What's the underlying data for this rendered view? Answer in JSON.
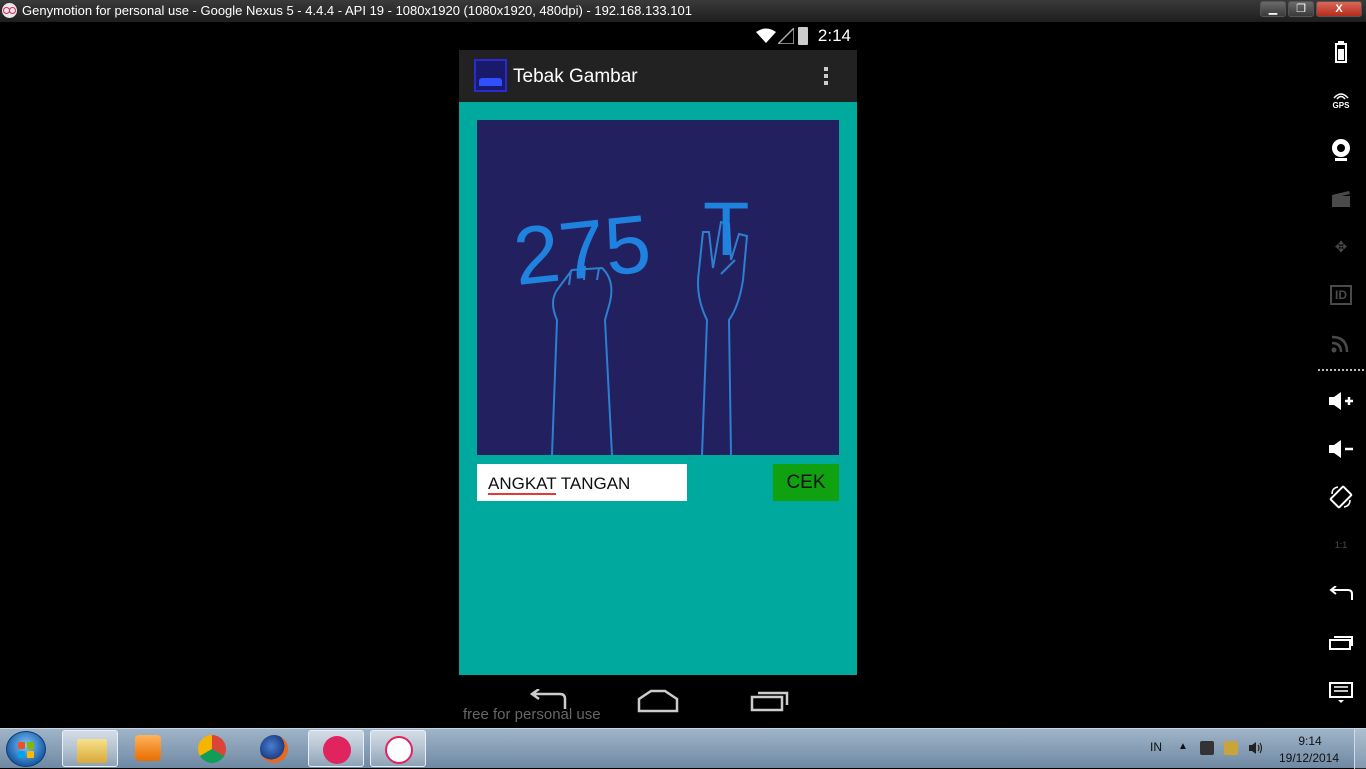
{
  "window": {
    "title": "Genymotion for personal use - Google Nexus 5 - 4.4.4 - API 19 - 1080x1920 (1080x1920, 480dpi) - 192.168.133.101",
    "minimize": "▁",
    "maximize": "❐",
    "close": "X"
  },
  "statusbar": {
    "time": "2:14"
  },
  "app": {
    "title": "Tebak Gambar"
  },
  "puzzle": {
    "number_text": "275",
    "letter_text": "T"
  },
  "answer": {
    "value_part1": "ANGKAT",
    "value_part2": " TANGAN"
  },
  "check_button": {
    "label": "CEK"
  },
  "watermark": "free for personal use",
  "sidebar": {
    "items": [
      {
        "icon": "battery-icon",
        "enabled": true
      },
      {
        "icon": "gps-icon",
        "label": "GPS",
        "enabled": true
      },
      {
        "icon": "webcam-icon",
        "enabled": true
      },
      {
        "icon": "screencast-icon",
        "enabled": false
      },
      {
        "icon": "move-icon",
        "enabled": false
      },
      {
        "icon": "id-icon",
        "label": "ID",
        "enabled": false
      },
      {
        "icon": "rss-icon",
        "enabled": false
      },
      {
        "icon": "volume-up-icon",
        "enabled": true
      },
      {
        "icon": "volume-down-icon",
        "enabled": true
      },
      {
        "icon": "rotate-icon",
        "enabled": true
      },
      {
        "icon": "scale-icon",
        "label": "1:1",
        "enabled": false
      },
      {
        "icon": "back-icon",
        "enabled": true
      },
      {
        "icon": "recent-apps-icon",
        "enabled": true
      },
      {
        "icon": "menu-icon",
        "enabled": true
      }
    ]
  },
  "taskbar": {
    "apps": [
      "windows-explorer-icon",
      "media-player-icon",
      "chrome-icon",
      "firefox-icon",
      "genymotion-icon",
      "genymotion-player-icon"
    ],
    "language": "IN",
    "time": "9:14",
    "date": "19/12/2014"
  },
  "colors": {
    "content_bg": "#00a99e",
    "puzzle_bg": "#23205f",
    "button_bg": "#0fa10f",
    "action_bar": "#222222"
  }
}
